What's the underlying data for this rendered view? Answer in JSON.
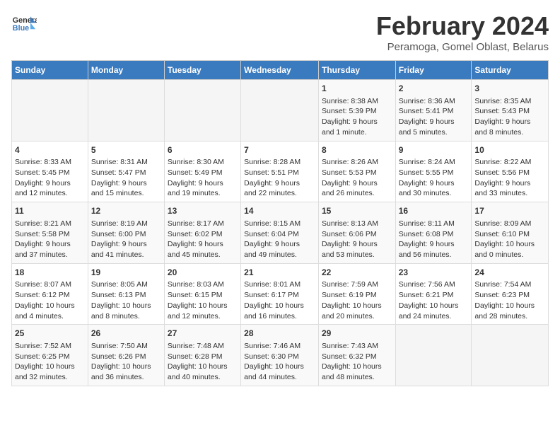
{
  "header": {
    "logo_line1": "General",
    "logo_line2": "Blue",
    "month_title": "February 2024",
    "subtitle": "Peramoga, Gomel Oblast, Belarus"
  },
  "days_of_week": [
    "Sunday",
    "Monday",
    "Tuesday",
    "Wednesday",
    "Thursday",
    "Friday",
    "Saturday"
  ],
  "weeks": [
    [
      {
        "day": "",
        "info": ""
      },
      {
        "day": "",
        "info": ""
      },
      {
        "day": "",
        "info": ""
      },
      {
        "day": "",
        "info": ""
      },
      {
        "day": "1",
        "info": "Sunrise: 8:38 AM\nSunset: 5:39 PM\nDaylight: 9 hours\nand 1 minute."
      },
      {
        "day": "2",
        "info": "Sunrise: 8:36 AM\nSunset: 5:41 PM\nDaylight: 9 hours\nand 5 minutes."
      },
      {
        "day": "3",
        "info": "Sunrise: 8:35 AM\nSunset: 5:43 PM\nDaylight: 9 hours\nand 8 minutes."
      }
    ],
    [
      {
        "day": "4",
        "info": "Sunrise: 8:33 AM\nSunset: 5:45 PM\nDaylight: 9 hours\nand 12 minutes."
      },
      {
        "day": "5",
        "info": "Sunrise: 8:31 AM\nSunset: 5:47 PM\nDaylight: 9 hours\nand 15 minutes."
      },
      {
        "day": "6",
        "info": "Sunrise: 8:30 AM\nSunset: 5:49 PM\nDaylight: 9 hours\nand 19 minutes."
      },
      {
        "day": "7",
        "info": "Sunrise: 8:28 AM\nSunset: 5:51 PM\nDaylight: 9 hours\nand 22 minutes."
      },
      {
        "day": "8",
        "info": "Sunrise: 8:26 AM\nSunset: 5:53 PM\nDaylight: 9 hours\nand 26 minutes."
      },
      {
        "day": "9",
        "info": "Sunrise: 8:24 AM\nSunset: 5:55 PM\nDaylight: 9 hours\nand 30 minutes."
      },
      {
        "day": "10",
        "info": "Sunrise: 8:22 AM\nSunset: 5:56 PM\nDaylight: 9 hours\nand 33 minutes."
      }
    ],
    [
      {
        "day": "11",
        "info": "Sunrise: 8:21 AM\nSunset: 5:58 PM\nDaylight: 9 hours\nand 37 minutes."
      },
      {
        "day": "12",
        "info": "Sunrise: 8:19 AM\nSunset: 6:00 PM\nDaylight: 9 hours\nand 41 minutes."
      },
      {
        "day": "13",
        "info": "Sunrise: 8:17 AM\nSunset: 6:02 PM\nDaylight: 9 hours\nand 45 minutes."
      },
      {
        "day": "14",
        "info": "Sunrise: 8:15 AM\nSunset: 6:04 PM\nDaylight: 9 hours\nand 49 minutes."
      },
      {
        "day": "15",
        "info": "Sunrise: 8:13 AM\nSunset: 6:06 PM\nDaylight: 9 hours\nand 53 minutes."
      },
      {
        "day": "16",
        "info": "Sunrise: 8:11 AM\nSunset: 6:08 PM\nDaylight: 9 hours\nand 56 minutes."
      },
      {
        "day": "17",
        "info": "Sunrise: 8:09 AM\nSunset: 6:10 PM\nDaylight: 10 hours\nand 0 minutes."
      }
    ],
    [
      {
        "day": "18",
        "info": "Sunrise: 8:07 AM\nSunset: 6:12 PM\nDaylight: 10 hours\nand 4 minutes."
      },
      {
        "day": "19",
        "info": "Sunrise: 8:05 AM\nSunset: 6:13 PM\nDaylight: 10 hours\nand 8 minutes."
      },
      {
        "day": "20",
        "info": "Sunrise: 8:03 AM\nSunset: 6:15 PM\nDaylight: 10 hours\nand 12 minutes."
      },
      {
        "day": "21",
        "info": "Sunrise: 8:01 AM\nSunset: 6:17 PM\nDaylight: 10 hours\nand 16 minutes."
      },
      {
        "day": "22",
        "info": "Sunrise: 7:59 AM\nSunset: 6:19 PM\nDaylight: 10 hours\nand 20 minutes."
      },
      {
        "day": "23",
        "info": "Sunrise: 7:56 AM\nSunset: 6:21 PM\nDaylight: 10 hours\nand 24 minutes."
      },
      {
        "day": "24",
        "info": "Sunrise: 7:54 AM\nSunset: 6:23 PM\nDaylight: 10 hours\nand 28 minutes."
      }
    ],
    [
      {
        "day": "25",
        "info": "Sunrise: 7:52 AM\nSunset: 6:25 PM\nDaylight: 10 hours\nand 32 minutes."
      },
      {
        "day": "26",
        "info": "Sunrise: 7:50 AM\nSunset: 6:26 PM\nDaylight: 10 hours\nand 36 minutes."
      },
      {
        "day": "27",
        "info": "Sunrise: 7:48 AM\nSunset: 6:28 PM\nDaylight: 10 hours\nand 40 minutes."
      },
      {
        "day": "28",
        "info": "Sunrise: 7:46 AM\nSunset: 6:30 PM\nDaylight: 10 hours\nand 44 minutes."
      },
      {
        "day": "29",
        "info": "Sunrise: 7:43 AM\nSunset: 6:32 PM\nDaylight: 10 hours\nand 48 minutes."
      },
      {
        "day": "",
        "info": ""
      },
      {
        "day": "",
        "info": ""
      }
    ]
  ]
}
